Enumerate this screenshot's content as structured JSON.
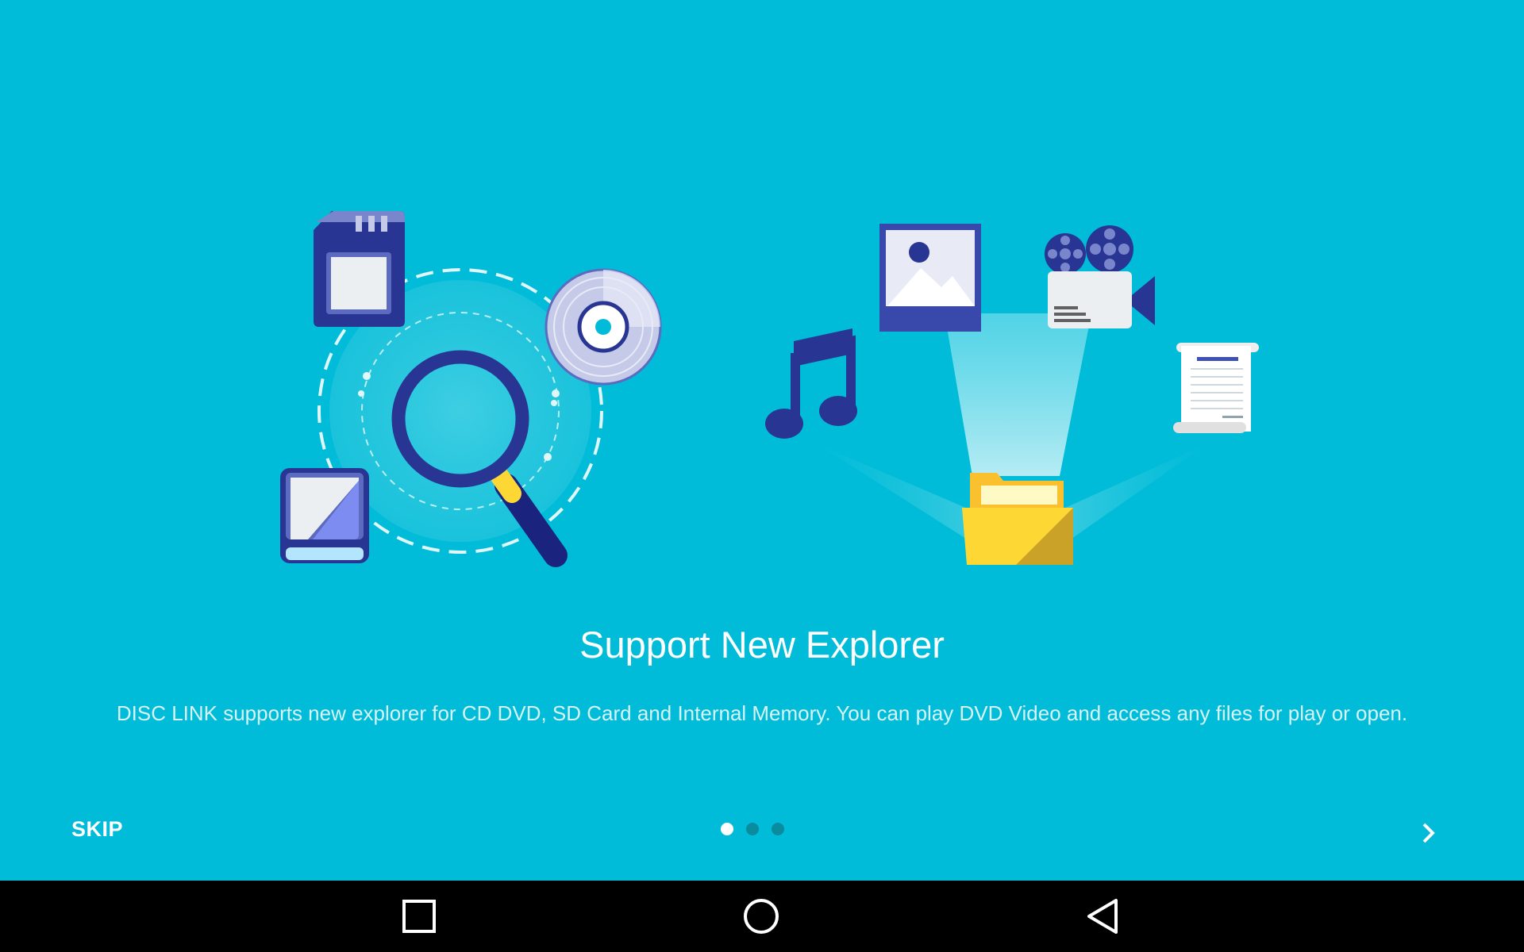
{
  "onboarding": {
    "title": "Support New Explorer",
    "description": "DISC LINK supports new explorer for CD DVD, SD Card and Internal Memory. You can play DVD Video and access any files for play or open.",
    "skip_label": "SKIP",
    "page_count": 3,
    "current_page": 1,
    "next_icon": "chevron-right-icon"
  },
  "illustration": {
    "left_group_icons": [
      "sd-card-icon",
      "cd-disc-icon",
      "magnifier-icon",
      "internal-storage-icon"
    ],
    "right_group_icons": [
      "music-note-icon",
      "image-icon",
      "video-camera-icon",
      "document-icon",
      "folder-icon"
    ]
  },
  "navbar": {
    "icons": [
      "recents-square-icon",
      "home-circle-icon",
      "back-triangle-icon"
    ]
  },
  "colors": {
    "background": "#00bcd8",
    "accent_dark": "#283593",
    "folder_yellow": "#fdd835",
    "navbar": "#000000"
  }
}
